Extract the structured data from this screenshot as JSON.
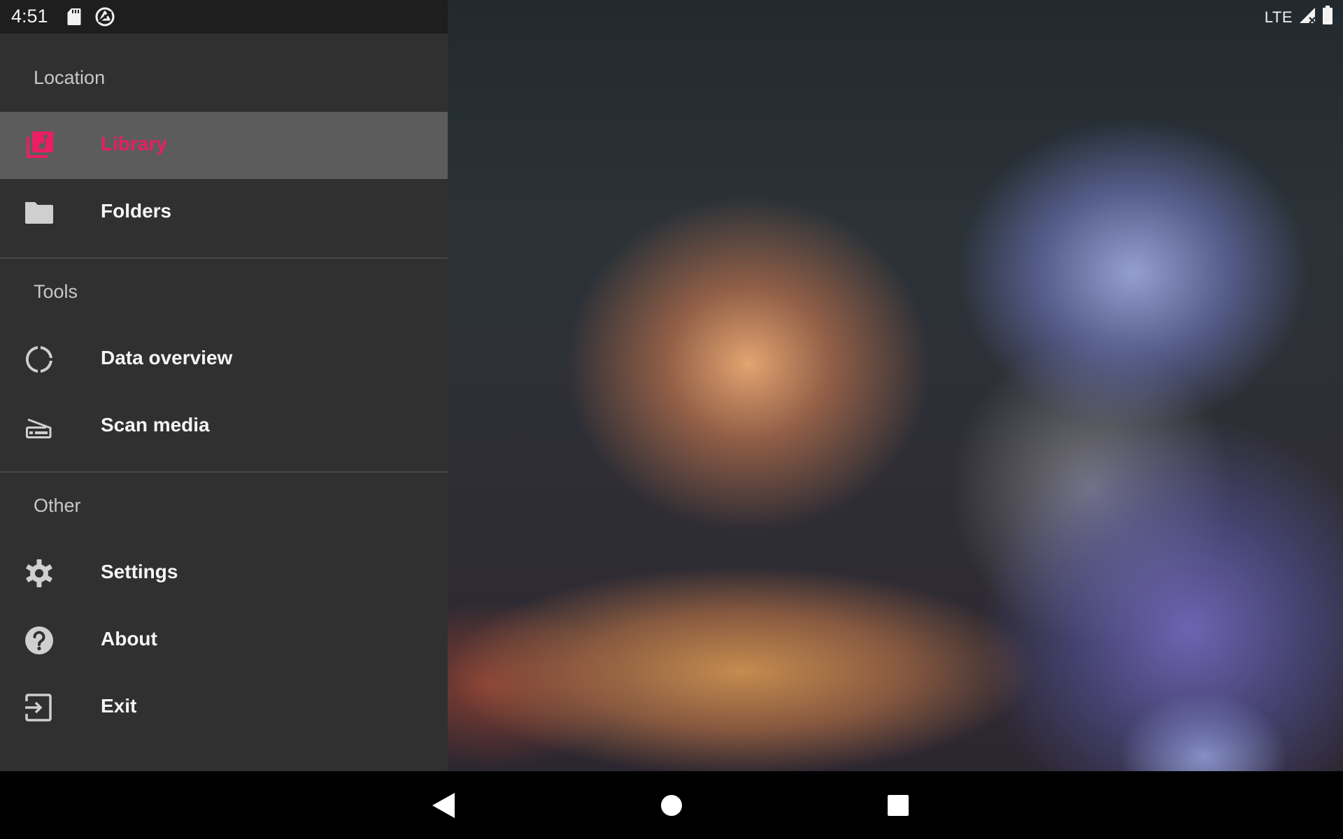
{
  "status_bar": {
    "time": "4:51",
    "network": "LTE",
    "icons": [
      "sd-card-icon",
      "sync-icon",
      "signal-icon",
      "battery-icon"
    ]
  },
  "drawer": {
    "sections": [
      {
        "header": "Location",
        "items": [
          {
            "label": "Library",
            "icon": "library-music-icon",
            "selected": true
          },
          {
            "label": "Folders",
            "icon": "folder-icon",
            "selected": false
          }
        ]
      },
      {
        "header": "Tools",
        "items": [
          {
            "label": "Data overview",
            "icon": "donut-chart-icon",
            "selected": false
          },
          {
            "label": "Scan media",
            "icon": "scanner-icon",
            "selected": false
          }
        ]
      },
      {
        "header": "Other",
        "items": [
          {
            "label": "Settings",
            "icon": "gear-icon",
            "selected": false
          },
          {
            "label": "About",
            "icon": "help-icon",
            "selected": false
          },
          {
            "label": "Exit",
            "icon": "exit-icon",
            "selected": false
          }
        ]
      }
    ]
  },
  "colors": {
    "accent": "#e91e63",
    "drawer_bg": "#303030",
    "selected_bg": "#5c5c5c",
    "icon": "#cfcfcf"
  },
  "nav_bar": {
    "buttons": [
      "back-icon",
      "home-icon",
      "recents-icon"
    ]
  }
}
